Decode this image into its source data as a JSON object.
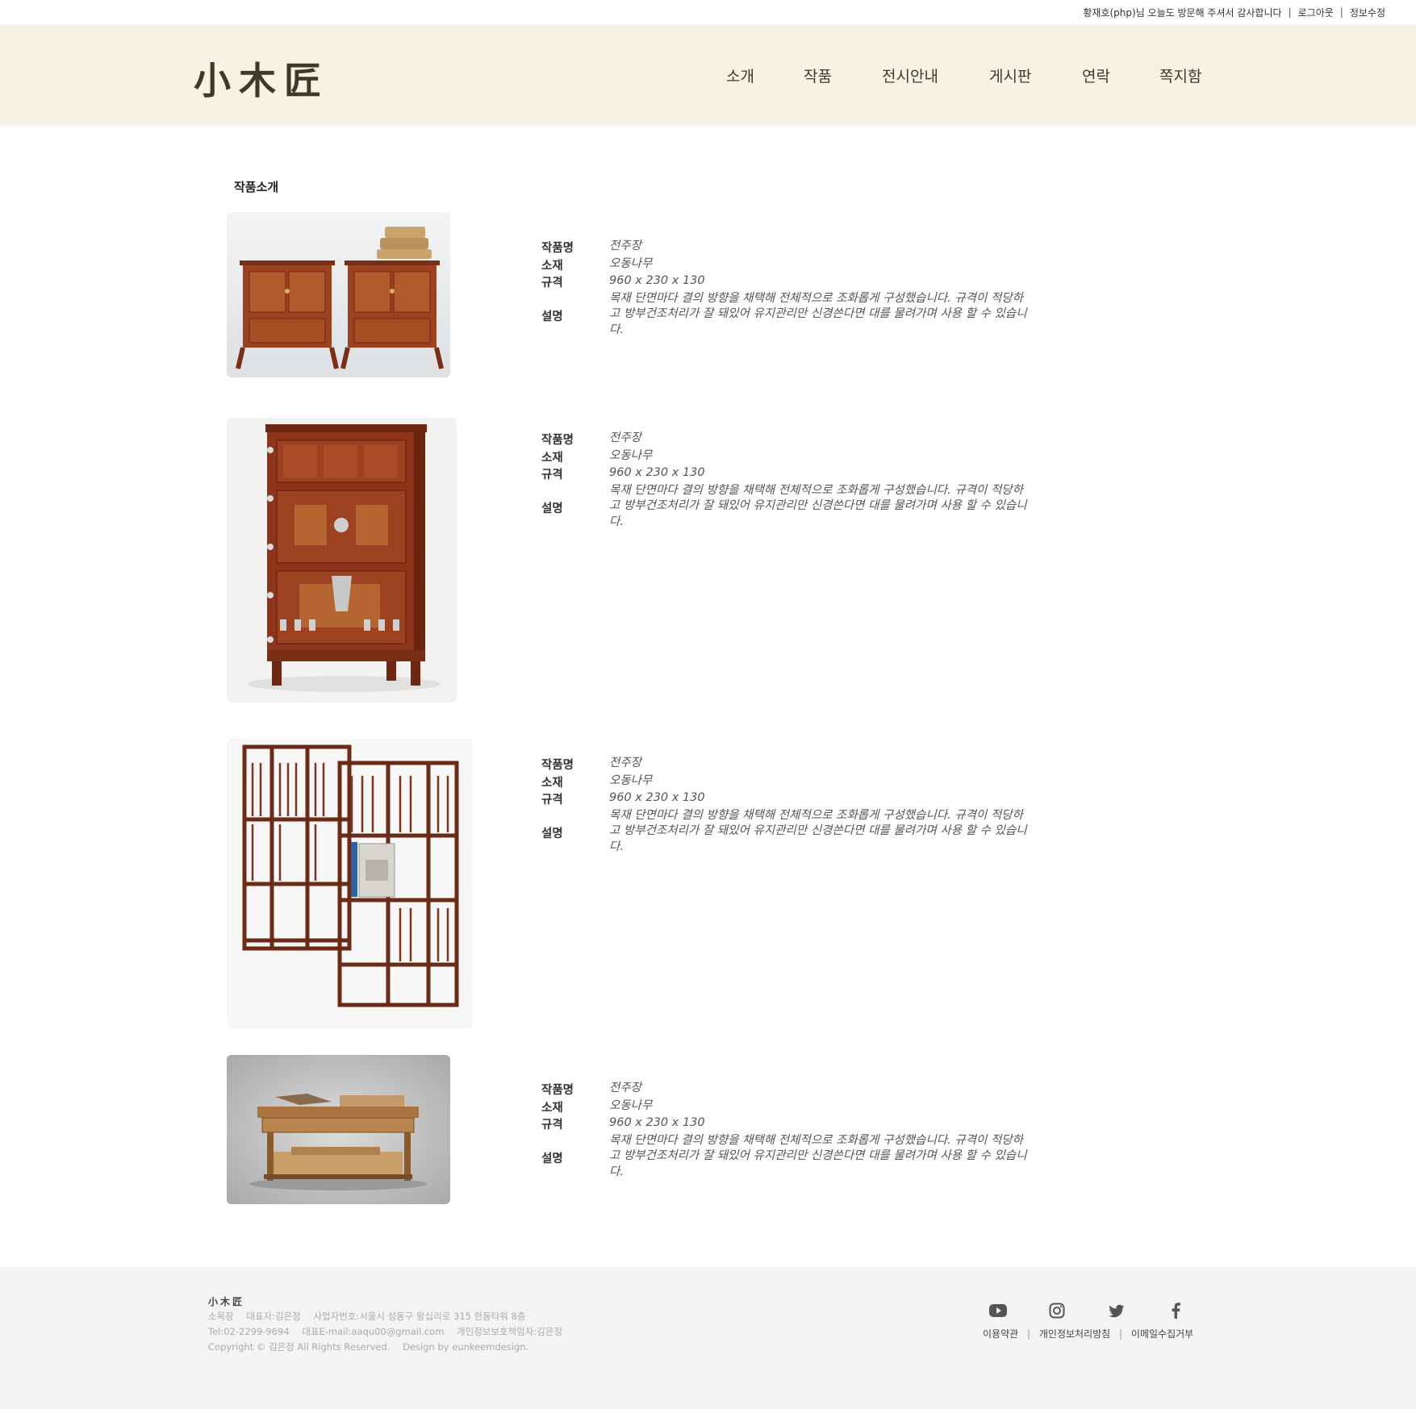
{
  "topbar": {
    "greeting": "황재호(php)님 오늘도 방문해 주셔서 감사합니다",
    "separator": "|",
    "logout": "로그아웃",
    "edit_info": "정보수정"
  },
  "header": {
    "logo": "小木匠",
    "nav": [
      "소개",
      "작품",
      "전시안내",
      "게시판",
      "연락",
      "쪽지함"
    ]
  },
  "main": {
    "section_title": "작품소개",
    "labels": {
      "name": "작품명",
      "material": "소재",
      "size": "규격",
      "description": "설명"
    },
    "works": [
      {
        "name": "전주장",
        "material": "오동나무",
        "size": "960 x 230 x 130",
        "description": "목재 단면마다 결의 방향을 채택해 전체적으로 조화롭게 구성했습니다. 규격이 적당하고 방부건조처리가 잘 돼있어 유지관리만 신경쓴다면 대를 물려가며 사용 할 수 있습니다."
      },
      {
        "name": "전주장",
        "material": "오동나무",
        "size": "960 x 230 x 130",
        "description": "목재 단면마다 결의 방향을 채택해 전체적으로 조화롭게 구성했습니다. 규격이 적당하고 방부건조처리가 잘 돼있어 유지관리만 신경쓴다면 대를 물려가며 사용 할 수 있습니다."
      },
      {
        "name": "전주장",
        "material": "오동나무",
        "size": "960 x 230 x 130",
        "description": "목재 단면마다 결의 방향을 채택해 전체적으로 조화롭게 구성했습니다. 규격이 적당하고 방부건조처리가 잘 돼있어 유지관리만 신경쓴다면 대를 물려가며 사용 할 수 있습니다."
      },
      {
        "name": "전주장",
        "material": "오동나무",
        "size": "960 x 230 x 130",
        "description": "목재 단면마다 결의 방향을 채택해 전체적으로 조화롭게 구성했습니다. 규격이 적당하고 방부건조처리가 잘 돼있어 유지관리만 신경쓴다면 대를 물려가며 사용 할 수 있습니다."
      }
    ]
  },
  "footer": {
    "logo": "小木匠",
    "line1": [
      "소목장",
      "대표자:김은정",
      "사업자번호:서울시 성동구 왕십리로 315 한동타워 8층"
    ],
    "line2": [
      "Tel:02-2299-9694",
      "대표E-mail:aaqu00@gmail.com",
      "개인정보보호책임자:김은정"
    ],
    "line3": [
      "Copyright © 김은정  All Rights Reserved.",
      "Design by eunkeemdesign."
    ],
    "social_icons": [
      "youtube-icon",
      "instagram-icon",
      "twitter-icon",
      "facebook-icon"
    ],
    "links": [
      "이용약관",
      "개인정보처리방침",
      "이메일수집거부"
    ],
    "separator": "|"
  },
  "colors": {
    "header_bg": "#f7f2e6",
    "logo": "#3d3a2a",
    "footer_bg": "#f4f4f2",
    "wood": "#8a3a1e"
  }
}
